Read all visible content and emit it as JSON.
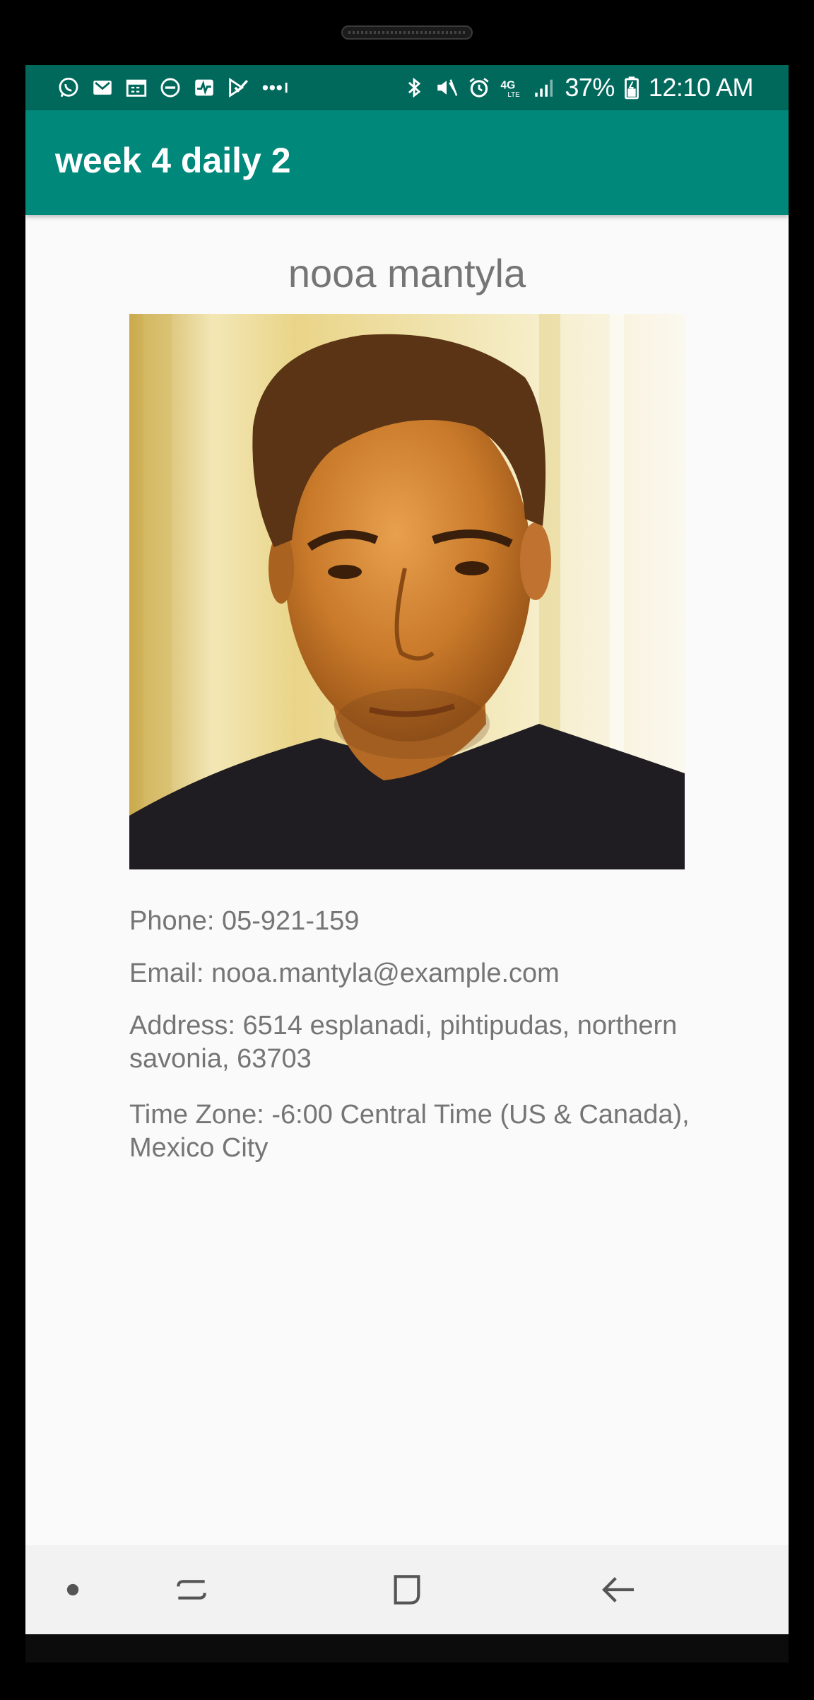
{
  "status_bar": {
    "battery": "37%",
    "time": "12:10 AM",
    "icons": [
      "whatsapp-icon",
      "gmail-icon",
      "calendar-icon",
      "do-not-disturb-icon",
      "health-icon",
      "task-icon",
      "more-notifications-icon",
      "bluetooth-icon",
      "mute-icon",
      "alarm-icon",
      "4g-lte-icon",
      "signal-icon",
      "battery-icon"
    ]
  },
  "app_bar": {
    "title": "week 4 daily 2"
  },
  "profile": {
    "name": "nooa mantyla",
    "phone": "Phone: 05-921-159",
    "email": "Email: nooa.mantyla@example.com",
    "address": "Address: 6514 esplanadi, pihtipudas, northern savonia, 63703",
    "timezone": "Time Zone: -6:00 Central Time (US & Canada), Mexico City"
  },
  "nav_bar": {
    "buttons": [
      "dot-icon",
      "recent-apps-icon",
      "home-icon",
      "back-icon"
    ]
  },
  "colors": {
    "status_bar": "#00695c",
    "app_bar": "#00897b",
    "background": "#fafafa",
    "text_gray": "#757575"
  }
}
